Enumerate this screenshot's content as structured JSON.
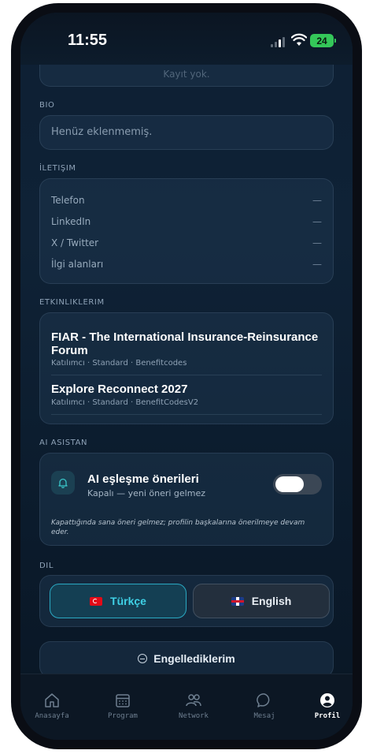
{
  "status_bar": {
    "time": "11:55",
    "battery": "24"
  },
  "top_card": {
    "text": "Kayıt yok."
  },
  "bio": {
    "label": "BIO",
    "value": "Henüz eklenmemiş."
  },
  "contact": {
    "label": "İLETIŞIM",
    "rows": [
      {
        "label": "Telefon",
        "value": "—"
      },
      {
        "label": "LinkedIn",
        "value": "—"
      },
      {
        "label": "X / Twitter",
        "value": "—"
      },
      {
        "label": "İlgi alanları",
        "value": "—"
      }
    ]
  },
  "events": {
    "label": "ETKINLIKLERIM",
    "items": [
      {
        "title": "FIAR - The International Insurance-Reinsurance Forum",
        "sub": "Katılımcı · Standard · Benefitcodes"
      },
      {
        "title": "Explore Reconnect 2027",
        "sub": "Katılımcı · Standard · BenefitCodesV2"
      }
    ]
  },
  "ai": {
    "label": "AI ASISTAN",
    "title": "AI eşleşme önerileri",
    "subtitle": "Kapalı — yeni öneri gelmez",
    "note": "Kapattığında sana öneri gelmez; profilin başkalarına önerilmeye devam eder.",
    "enabled": false
  },
  "language": {
    "label": "DIL",
    "options": [
      {
        "label": "Türkçe",
        "selected": true
      },
      {
        "label": "English",
        "selected": false
      }
    ]
  },
  "blocked": {
    "label": "Engellediklerim"
  },
  "tabs": [
    {
      "label": "Anasayfa",
      "icon": "home-icon"
    },
    {
      "label": "Program",
      "icon": "calendar-icon"
    },
    {
      "label": "Network",
      "icon": "people-icon"
    },
    {
      "label": "Mesaj",
      "icon": "message-icon"
    },
    {
      "label": "Profil",
      "icon": "profile-icon",
      "active": true
    }
  ],
  "colors": {
    "accent": "#3fd1e6",
    "battery": "#34c759"
  }
}
